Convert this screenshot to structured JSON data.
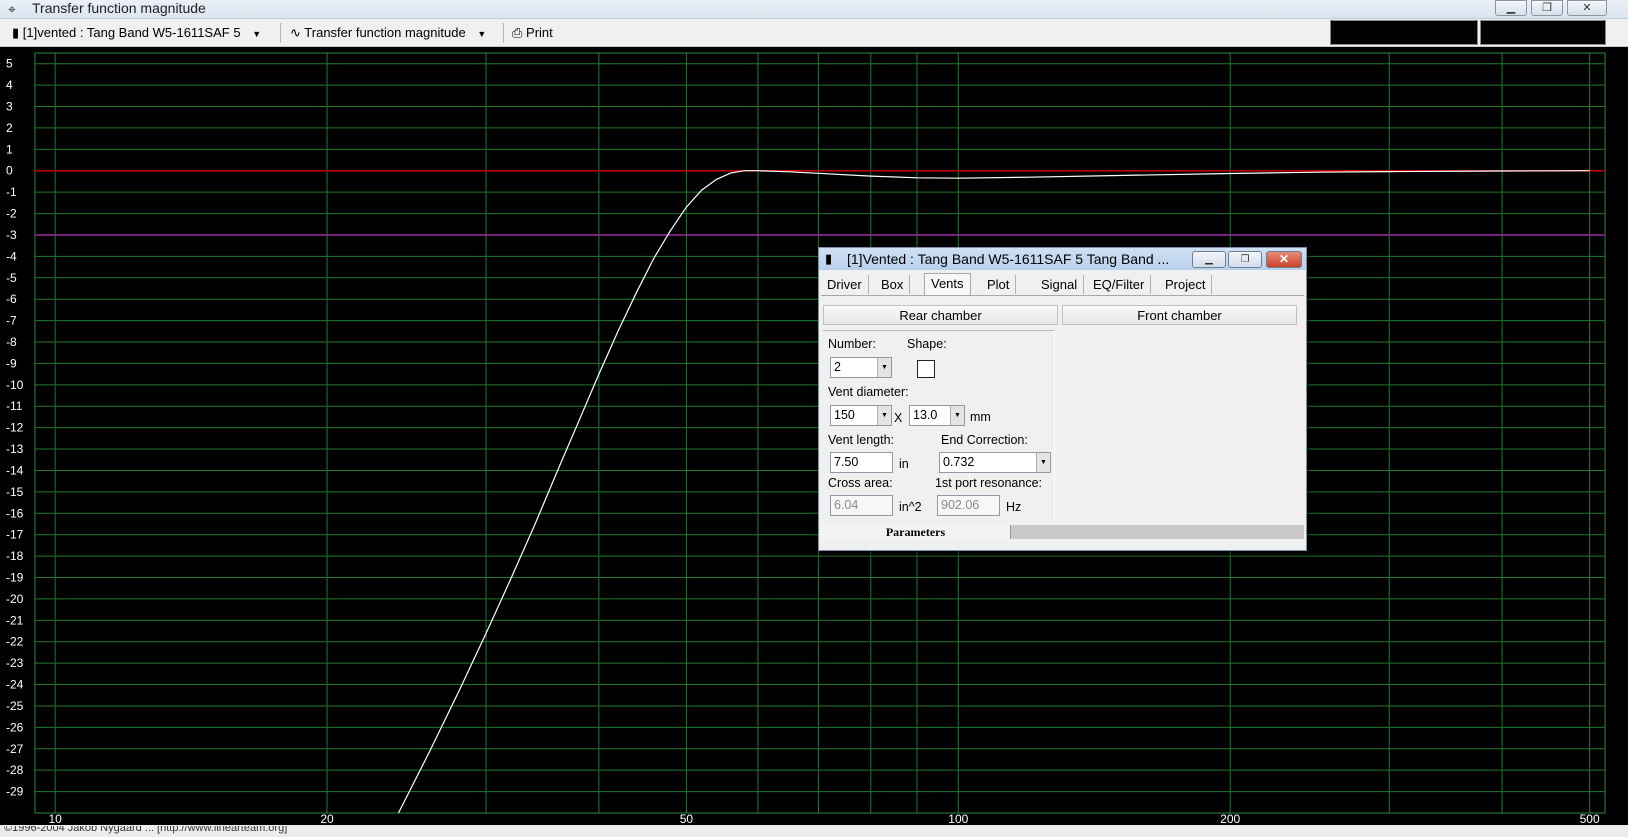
{
  "window": {
    "title": "Transfer function magnitude"
  },
  "toolbar": {
    "project_select": "[1]vented : Tang Band W5-1611SAF 5",
    "graph_select": "Transfer function magnitude",
    "print_label": "Print"
  },
  "status_text": "©1996-2004 Jakob Nygaard ... [http://www.linearteam.org]",
  "chart_data": {
    "type": "line",
    "xscale": "log",
    "xlim": [
      9.5,
      520
    ],
    "ylim": [
      -30,
      5.5
    ],
    "grid": true,
    "x_ticks": [
      10,
      20,
      50,
      100,
      200,
      500
    ],
    "y_ticks": [
      5,
      4,
      3,
      2,
      1,
      0,
      -1,
      -2,
      -3,
      -4,
      -5,
      -6,
      -7,
      -8,
      -9,
      -10,
      -11,
      -12,
      -13,
      -14,
      -15,
      -16,
      -17,
      -18,
      -19,
      -20,
      -21,
      -22,
      -23,
      -24,
      -25,
      -26,
      -27,
      -28,
      -29
    ],
    "reference_lines": [
      {
        "y": 0,
        "color": "#c00000"
      },
      {
        "y": -3,
        "color": "#9a2a9a"
      }
    ],
    "series": [
      {
        "color": "#ffffff",
        "x": [
          24,
          26,
          28,
          30,
          32,
          34,
          36,
          38,
          40,
          42,
          44,
          46,
          48,
          50,
          52,
          54,
          56,
          58,
          60,
          65,
          70,
          80,
          90,
          100,
          120,
          150,
          200,
          250,
          300,
          400,
          500
        ],
        "y": [
          -30,
          -27.1,
          -24.3,
          -21.6,
          -19,
          -16.5,
          -14,
          -11.7,
          -9.5,
          -7.5,
          -5.7,
          -4.1,
          -2.8,
          -1.7,
          -0.9,
          -0.4,
          -0.1,
          0,
          0,
          -0.05,
          -0.12,
          -0.25,
          -0.33,
          -0.35,
          -0.3,
          -0.22,
          -0.13,
          -0.07,
          -0.04,
          -0.01,
          0
        ]
      }
    ]
  },
  "dialog": {
    "title": "[1]Vented : Tang Band W5-1611SAF 5 Tang Band ...",
    "tabs": [
      "Driver",
      "Box",
      "Vents",
      "Plot",
      "Signal",
      "EQ/Filter",
      "Project"
    ],
    "active_tab": "Vents",
    "rear_chamber_label": "Rear chamber",
    "front_chamber_label": "Front chamber",
    "number_label": "Number:",
    "number_value": "2",
    "shape_label": "Shape:",
    "vent_diameter_label": "Vent diameter:",
    "vent_diameter_value": "150",
    "vent_times": "X",
    "vent_height_value": "13.0",
    "vent_diameter_unit": "mm",
    "vent_length_label": "Vent length:",
    "vent_length_value": "7.50",
    "vent_length_unit": "in",
    "end_correction_label": "End Correction:",
    "end_correction_value": "0.732",
    "cross_area_label": "Cross area:",
    "cross_area_value": "6.04",
    "cross_area_unit": "in^2",
    "port_resonance_label": "1st port resonance:",
    "port_resonance_value": "902.06",
    "port_resonance_unit": "Hz",
    "footer_tab": "Parameters"
  }
}
